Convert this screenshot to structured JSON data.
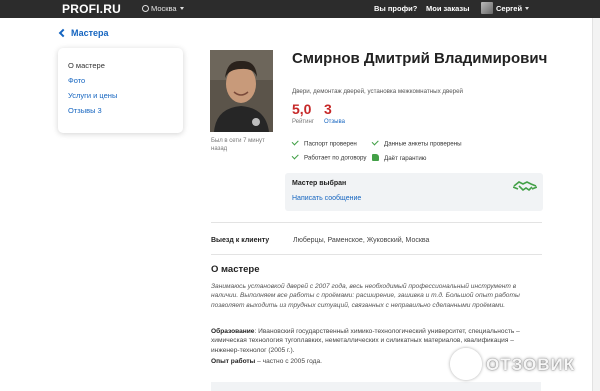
{
  "header": {
    "logo": "PROFI.RU",
    "city": "Москва",
    "nav_pro": "Вы профи?",
    "nav_orders": "Мои заказы",
    "user_name": "Сергей"
  },
  "back_link": "Мастера",
  "sidebar": {
    "items": [
      {
        "label": "О мастере",
        "active": true
      },
      {
        "label": "Фото",
        "active": false
      },
      {
        "label": "Услуги и цены",
        "active": false
      },
      {
        "label": "Отзывы 3",
        "active": false
      }
    ]
  },
  "profile": {
    "online_status": "Был в сети 7 минут назад",
    "name": "Смирнов Дмитрий Владимирович",
    "specialization": "Двери, демонтаж дверей, установка межкомнатных дверей",
    "rating": "5,0",
    "rating_label": "Рейтинг",
    "reviews_count": "3",
    "reviews_label": "Отзыва",
    "badges": [
      "Паспорт проверен",
      "Данные анкеты проверены",
      "Работает по договору",
      "Даёт гарантию"
    ]
  },
  "chosen": {
    "title": "Мастер выбран",
    "link": "Написать сообщение"
  },
  "departure": {
    "label": "Выезд к клиенту",
    "value": "Люберцы, Раменское, Жуковский, Москва"
  },
  "about": {
    "heading": "О мастере",
    "text": "Занимаюсь установкой дверей с 2007 года, весь необходимый профессиональный инструмент в наличии. Выполняем все работы с проёмами: расширение, зашивка и т.д. Большой опыт работы позволяет выходить из трудных ситуаций, связанных с неправильно сделанными проёмами.",
    "education_label": "Образование",
    "education_text": ": Ивановский государственный химико-технологический университет, специальность – химическая технология тугоплавких, неметаллических и силикатных материалов, квалификация – инженер-технолог (2005 г.).",
    "experience_label": "Опыт работы",
    "experience_text": " – частно с 2005 года."
  },
  "watermark": "ОТЗОВИК",
  "colors": {
    "topbar": "#2c2c2c",
    "link": "#1565c0",
    "rating": "#c62828",
    "verified": "#43a047"
  },
  "icons": [
    "location-icon",
    "chevron-left-icon",
    "check-icon",
    "thumbs-up-icon",
    "handshake-icon",
    "caret-down-icon"
  ]
}
